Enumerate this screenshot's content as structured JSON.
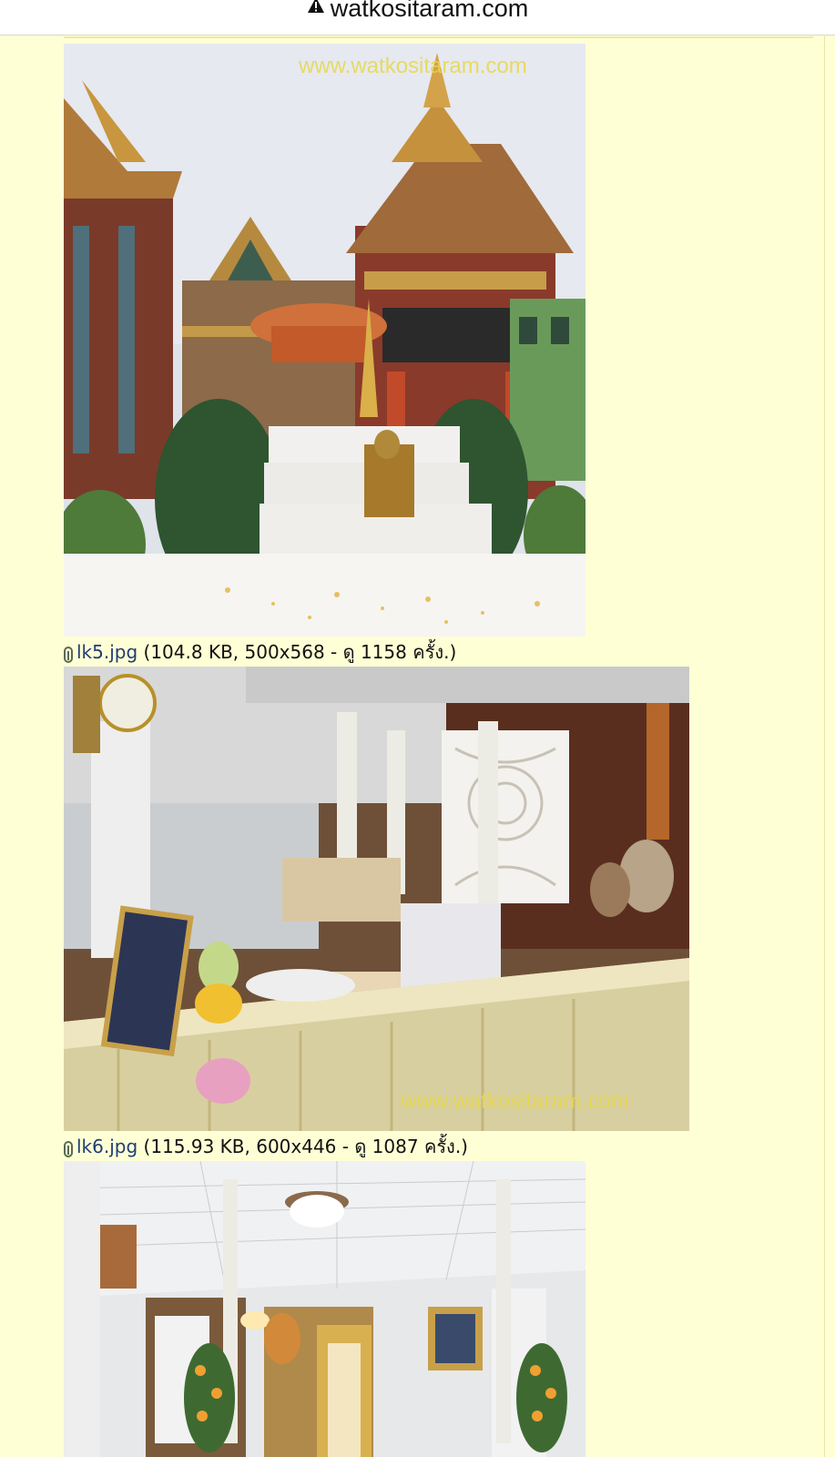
{
  "browser": {
    "url": "watkositaram.com",
    "warning_icon": "warning-triangle-icon"
  },
  "attachments": [
    {
      "watermark": "www.watkositaram.com"
    },
    {
      "filename": "lk5.jpg",
      "info": "(104.8 KB, 500x568 - ดู 1158 ครั้ง.)",
      "watermark": "www.watkositaram.com",
      "icon": "paperclip-icon"
    },
    {
      "filename": "lk6.jpg",
      "info": "(115.93 KB, 600x446 - ดู 1087 ครั้ง.)",
      "icon": "paperclip-icon"
    }
  ],
  "colors": {
    "page_bg": "#ffffd6",
    "link": "#1e3d74",
    "watermark": "#e8d84a"
  }
}
